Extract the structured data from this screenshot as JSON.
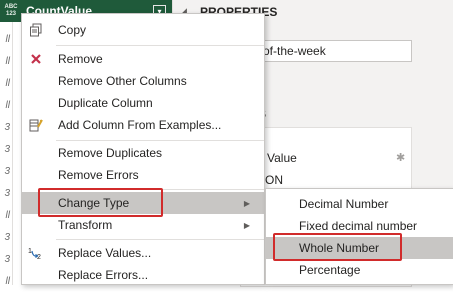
{
  "grid": {
    "column_type_top": "ABC",
    "column_type_bottom": "123",
    "column_name": "CountValue",
    "row_markers": [
      "ll",
      "ll",
      "ll",
      "ll",
      "3",
      "3",
      "3",
      "3",
      "ll",
      "3",
      "3",
      "ll",
      "ll"
    ]
  },
  "properties": {
    "title": "PROPERTIES",
    "name_value": "ion-of-the-week",
    "all_properties": "s",
    "steps_title": "PS",
    "steps": [
      "d Value",
      "SON"
    ]
  },
  "context_menu": {
    "items": [
      {
        "label": "Copy",
        "icon": "copy-icon"
      },
      {
        "label": "Remove",
        "icon": "remove-x-icon"
      },
      {
        "label": "Remove Other Columns",
        "icon": ""
      },
      {
        "label": "Duplicate Column",
        "icon": ""
      },
      {
        "label": "Add Column From Examples...",
        "icon": "add-column-examples-icon"
      },
      {
        "label": "Remove Duplicates",
        "icon": ""
      },
      {
        "label": "Remove Errors",
        "icon": ""
      },
      {
        "label": "Change Type",
        "icon": "",
        "highlighted": true,
        "submenu": true
      },
      {
        "label": "Transform",
        "icon": "",
        "submenu": true
      },
      {
        "label": "Replace Values...",
        "icon": "replace-values-icon"
      },
      {
        "label": "Replace Errors...",
        "icon": ""
      }
    ]
  },
  "change_type_submenu": {
    "items": [
      {
        "label": "Decimal Number"
      },
      {
        "label": "Fixed decimal number"
      },
      {
        "label": "Whole Number",
        "highlighted": true
      },
      {
        "label": "Percentage"
      }
    ]
  },
  "colors": {
    "header_bg": "#1f5a3a",
    "highlight_bg": "#c8c6c4",
    "callout_red": "#d12b2b",
    "remove_icon_red": "#c4314b",
    "pane_bg": "#f3f2f1"
  }
}
